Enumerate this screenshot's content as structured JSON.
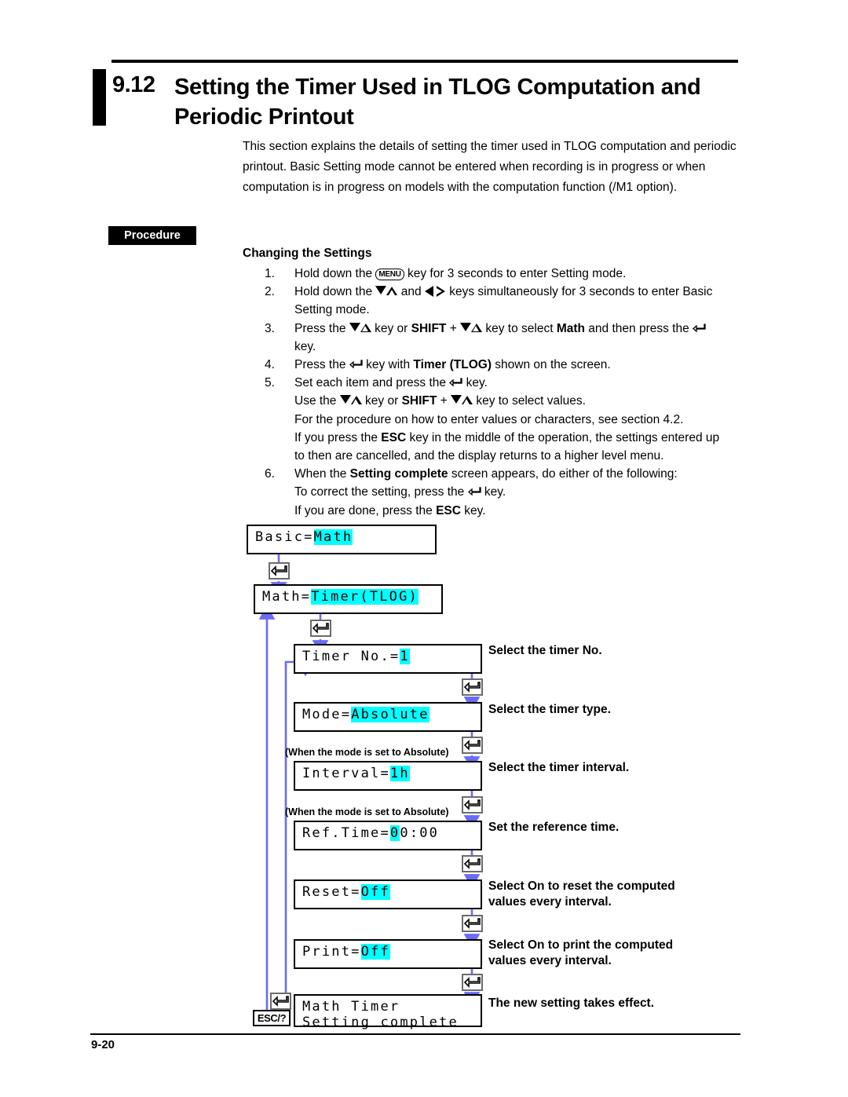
{
  "header": {
    "section_number": "9.12",
    "title": "Setting the Timer Used in TLOG Computation and Periodic Printout"
  },
  "intro": {
    "paragraph": "This section explains the details of setting the timer used in TLOG computation and periodic printout. Basic Setting mode cannot be entered when recording is in progress or when computation is in progress on models with the computation function (/M1 option)."
  },
  "procedure": {
    "badge_label": "Procedure",
    "heading": "Changing the Settings",
    "steps": [
      {
        "number": "1.",
        "lines": [
          "Hold down the [MENU] key for 3 seconds to enter Setting mode."
        ]
      },
      {
        "number": "2.",
        "lines": [
          "Hold down the ▽△ and ◁ ▷ keys simultaneously for 3 seconds to enter Basic",
          "Setting mode."
        ]
      },
      {
        "number": "3.",
        "lines": [
          "Press the ▽△ key or SHIFT + ▽△ key to select Math and then press the ↵",
          "key."
        ]
      },
      {
        "number": "4.",
        "lines": [
          "Press the ↵ key with Timer (TLOG) shown on the screen."
        ]
      },
      {
        "number": "5.",
        "lines": [
          "Set each item and press the ↵ key.",
          "Use the ▽△ key or SHIFT + ▽△ key to select values.",
          "For the procedure on how to enter values or characters, see section 4.2.",
          "If you press the ESC key in the middle of the operation, the settings entered up",
          "to then are cancelled, and the display returns to a higher level menu."
        ]
      },
      {
        "number": "6.",
        "lines": [
          "When the Setting complete screen appears, do either of the following:",
          "To correct the setting, press the ↵ key.",
          "If you are done, press the ESC key."
        ]
      }
    ],
    "step_text": {
      "s1_a": "Hold down the ",
      "s1_menu": "MENU",
      "s1_b": " key for 3 seconds to enter Setting mode.",
      "s2_a": "Hold down the ",
      "s2_b": " and ",
      "s2_c": " keys simultaneously for 3 seconds to enter Basic",
      "s2_d": "Setting mode.",
      "s3_a": "Press the ",
      "s3_b": " key or ",
      "s3_shift": "SHIFT",
      "s3_c": " + ",
      "s3_d": " key to select ",
      "s3_math": "Math",
      "s3_e": " and then press the ",
      "s3_f": "key.",
      "s4_a": "Press the ",
      "s4_b": " key with ",
      "s4_timer": "Timer (TLOG)",
      "s4_c": " shown on the screen.",
      "s5_a": "Set each item and press the ",
      "s5_b": " key.",
      "s5_c": "Use the ",
      "s5_d": " key or ",
      "s5_e": " + ",
      "s5_f": " key to select values.",
      "s5_g": "For the procedure on how to enter values or characters, see section 4.2.",
      "s5_h": "If you press the ",
      "s5_esc": "ESC",
      "s5_i": " key in the middle of the operation, the settings entered up",
      "s5_j": "to then are cancelled, and the display returns to a higher level menu.",
      "s6_a": "When the ",
      "s6_setting": "Setting complete",
      "s6_b": " screen appears, do either of the following:",
      "s6_c": "To correct the setting, press the ",
      "s6_d": " key.",
      "s6_e": "If you are done, press the ",
      "s6_f": " key."
    }
  },
  "flowchart": {
    "highlight_color": "#00ffff",
    "connector_color": "#6b6bf5",
    "esc_label": "ESC/?",
    "note_absolute": "(When the mode is set to Absolute)",
    "screens": [
      {
        "id": "basic",
        "prefix": "Basic=",
        "value": "Math"
      },
      {
        "id": "math",
        "prefix": "Math=",
        "value": "Timer(TLOG)"
      },
      {
        "id": "timerno",
        "prefix": "Timer No.=",
        "value": "1"
      },
      {
        "id": "mode",
        "prefix": "Mode=",
        "value": "Absolute"
      },
      {
        "id": "interval",
        "prefix": "Interval=",
        "value": "1h"
      },
      {
        "id": "reftime",
        "prefix": "Ref.Time=",
        "value": "0",
        "suffix": "0:00"
      },
      {
        "id": "reset",
        "prefix": "Reset=",
        "value": "Off"
      },
      {
        "id": "print",
        "prefix": "Print=",
        "value": "Off"
      },
      {
        "id": "complete",
        "line1": "Math Timer",
        "line2": "Setting complete"
      }
    ],
    "callouts": [
      {
        "id": "c-timerno",
        "line1": "Select the timer No.",
        "line2": ""
      },
      {
        "id": "c-mode",
        "line1": "Select the timer type.",
        "line2": ""
      },
      {
        "id": "c-interval",
        "line1": "Select the timer interval.",
        "line2": ""
      },
      {
        "id": "c-reftime",
        "line1": "Set the reference time.",
        "line2": ""
      },
      {
        "id": "c-reset",
        "line1": "Select On to reset the computed",
        "line2": "values every interval."
      },
      {
        "id": "c-print",
        "line1": "Select On to print the computed",
        "line2": "values every interval."
      },
      {
        "id": "c-complete",
        "line1": "The new setting takes effect.",
        "line2": ""
      }
    ]
  },
  "footer": {
    "page_number": "9-20"
  }
}
